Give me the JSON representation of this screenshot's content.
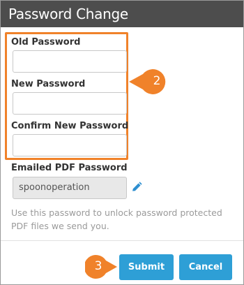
{
  "dialog": {
    "title": "Password Change"
  },
  "form": {
    "old_password_label": "Old Password",
    "old_password_value": "",
    "new_password_label": "New Password",
    "new_password_value": "",
    "confirm_password_label": "Confirm New Password",
    "confirm_password_value": "",
    "emailed_pdf_label": "Emailed PDF Password",
    "emailed_pdf_value": "spoonoperation",
    "help_text": "Use this password to unlock password protected PDF files we send you."
  },
  "actions": {
    "submit_label": "Submit",
    "cancel_label": "Cancel"
  },
  "callouts": {
    "fields_step": "2",
    "submit_step": "3"
  },
  "colors": {
    "header_bg": "#4d4d4d",
    "accent_orange": "#f0822a",
    "button_blue": "#2e9fd6"
  },
  "icons": {
    "edit": "pencil-icon"
  }
}
